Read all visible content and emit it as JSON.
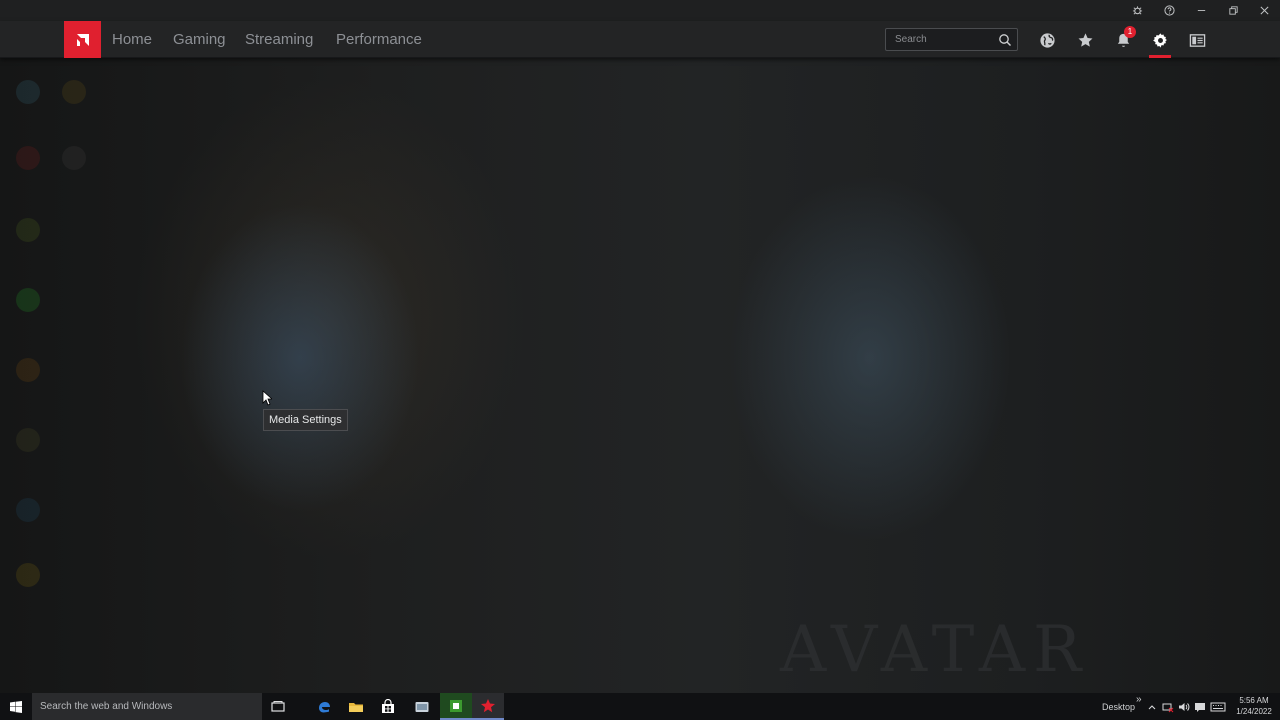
{
  "titlebar": {
    "icons": [
      "bug-icon",
      "help-icon",
      "minimize-icon",
      "restore-icon",
      "close-icon"
    ]
  },
  "header": {
    "logo": "amd-logo",
    "tabs": [
      {
        "label": "Home"
      },
      {
        "label": "Gaming"
      },
      {
        "label": "Streaming"
      },
      {
        "label": "Performance"
      }
    ],
    "search": {
      "placeholder": "Search"
    },
    "notification_count": "1",
    "right_icons": [
      "globe-icon",
      "star-icon",
      "bell-icon",
      "gear-icon",
      "layout-icon"
    ],
    "active_icon": "gear-icon",
    "accent_color": "#e0202f"
  },
  "background": {
    "title": "AVATAR"
  },
  "tooltip": {
    "text": "Media Settings"
  },
  "taskbar": {
    "search_placeholder": "Search the web and Windows",
    "apps": [
      "task-view-icon",
      "edge-icon",
      "file-explorer-icon",
      "store-icon",
      "app-icon",
      "media-app-icon",
      "amd-radeon-icon"
    ],
    "desktop_label": "Desktop",
    "chevron": "»",
    "time": "5:56 AM",
    "date": "1/24/2022"
  }
}
